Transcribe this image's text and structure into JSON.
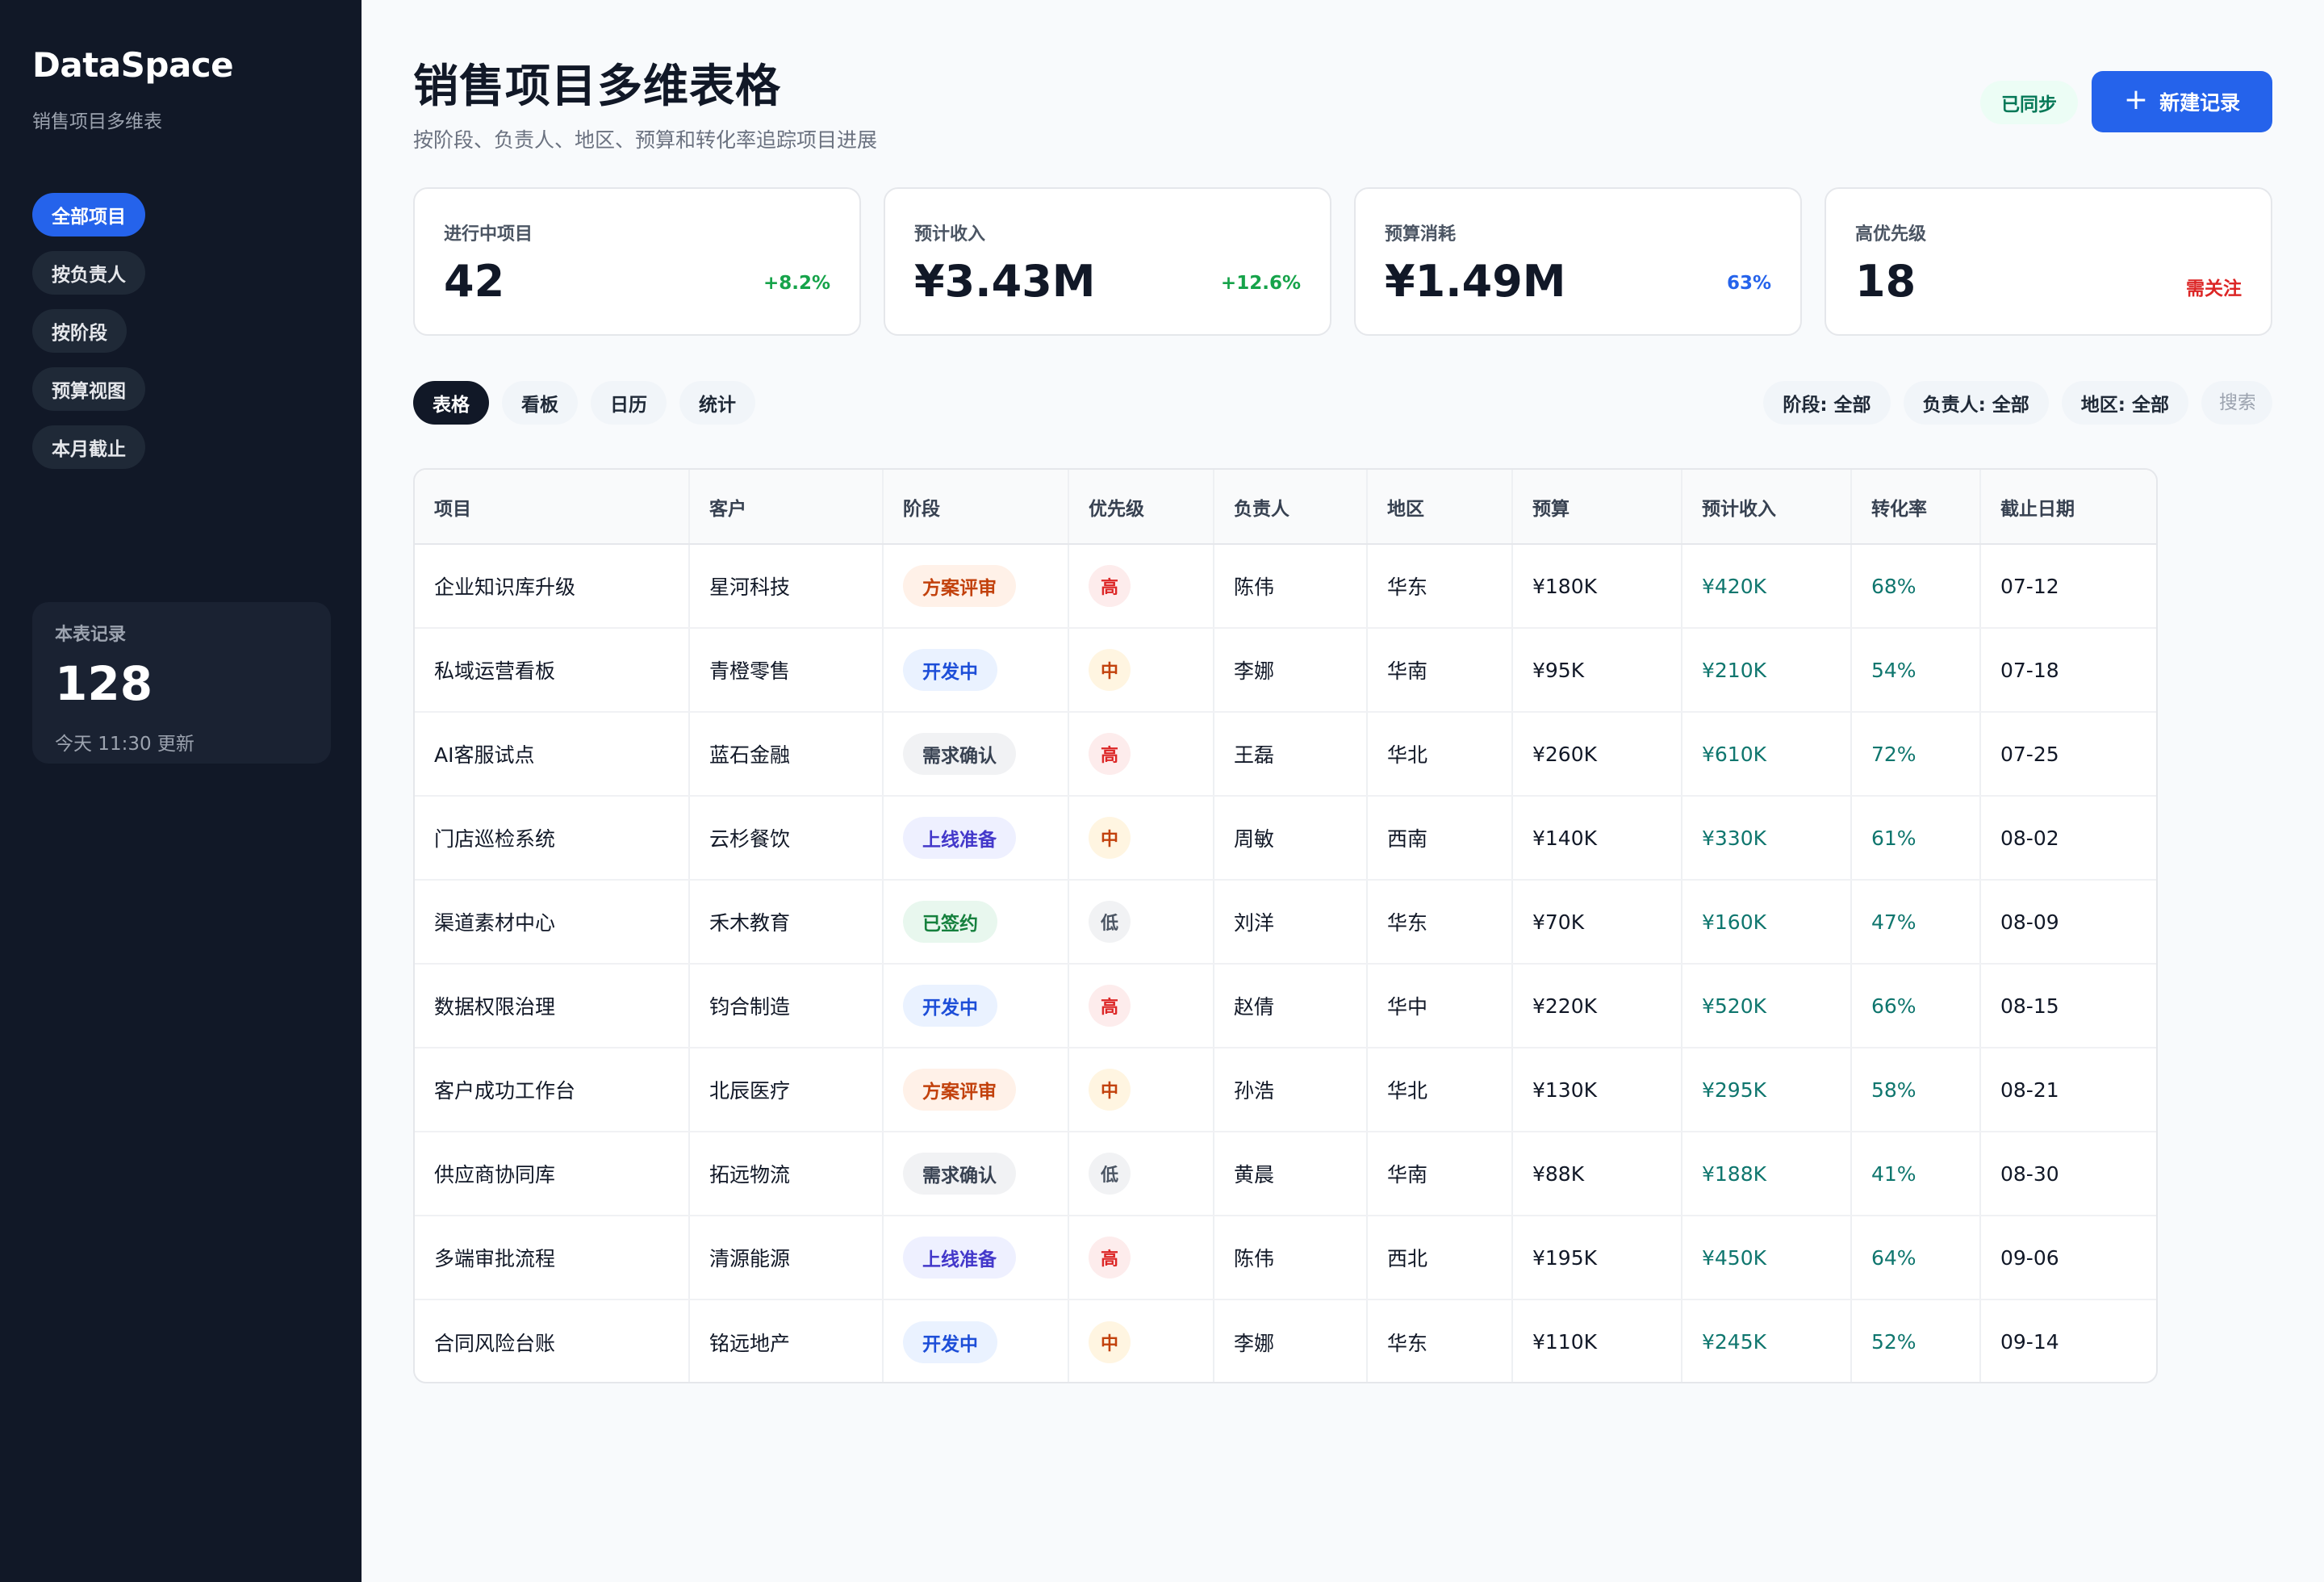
{
  "sidebar": {
    "brand": "DataSpace",
    "subtitle": "销售项目多维表",
    "nav": [
      {
        "label": "全部项目",
        "active": true
      },
      {
        "label": "按负责人",
        "active": false
      },
      {
        "label": "按阶段",
        "active": false
      },
      {
        "label": "预算视图",
        "active": false
      },
      {
        "label": "本月截止",
        "active": false
      }
    ],
    "records": {
      "label": "本表记录",
      "value": "128",
      "updated": "今天 11:30 更新"
    }
  },
  "header": {
    "title": "销售项目多维表格",
    "subtitle": "按阶段、负责人、地区、预算和转化率追踪项目进展",
    "sync_label": "已同步",
    "new_button": "新建记录"
  },
  "kpis": [
    {
      "label": "进行中项目",
      "value": "42",
      "delta": "+8.2%",
      "color": "#16a34a"
    },
    {
      "label": "预计收入",
      "value": "¥3.43M",
      "delta": "+12.6%",
      "color": "#16a34a"
    },
    {
      "label": "预算消耗",
      "value": "¥1.49M",
      "delta": "63%",
      "color": "#2563eb"
    },
    {
      "label": "高优先级",
      "value": "18",
      "delta": "需关注",
      "color": "#dc2626"
    }
  ],
  "view_tabs": [
    {
      "label": "表格",
      "active": true
    },
    {
      "label": "看板",
      "active": false
    },
    {
      "label": "日历",
      "active": false
    },
    {
      "label": "统计",
      "active": false
    }
  ],
  "filters": {
    "stage": "阶段: 全部",
    "owner": "负责人: 全部",
    "region": "地区: 全部",
    "search_placeholder": "搜索"
  },
  "stage_colors": {
    "方案评审": {
      "bg": "#fff1e8",
      "fg": "#c2410c"
    },
    "开发中": {
      "bg": "#eaf2ff",
      "fg": "#1d4ed8"
    },
    "需求确认": {
      "bg": "#f1f2f4",
      "fg": "#374151"
    },
    "上线准备": {
      "bg": "#eef0ff",
      "fg": "#4338ca"
    },
    "已签约": {
      "bg": "#e8f7ee",
      "fg": "#15803d"
    }
  },
  "priority_colors": {
    "高": {
      "bg": "#fdecec",
      "fg": "#dc2626"
    },
    "中": {
      "bg": "#fff5e1",
      "fg": "#c2410c"
    },
    "低": {
      "bg": "#f1f2f4",
      "fg": "#4b5563"
    }
  },
  "table": {
    "columns": [
      "项目",
      "客户",
      "阶段",
      "优先级",
      "负责人",
      "地区",
      "预算",
      "预计收入",
      "转化率",
      "截止日期"
    ],
    "rows": [
      {
        "project": "企业知识库升级",
        "client": "星河科技",
        "stage": "方案评审",
        "priority": "高",
        "owner": "陈伟",
        "region": "华东",
        "budget": "¥180K",
        "revenue": "¥420K",
        "conversion": "68%",
        "due": "07-12"
      },
      {
        "project": "私域运营看板",
        "client": "青橙零售",
        "stage": "开发中",
        "priority": "中",
        "owner": "李娜",
        "region": "华南",
        "budget": "¥95K",
        "revenue": "¥210K",
        "conversion": "54%",
        "due": "07-18"
      },
      {
        "project": "AI客服试点",
        "client": "蓝石金融",
        "stage": "需求确认",
        "priority": "高",
        "owner": "王磊",
        "region": "华北",
        "budget": "¥260K",
        "revenue": "¥610K",
        "conversion": "72%",
        "due": "07-25"
      },
      {
        "project": "门店巡检系统",
        "client": "云杉餐饮",
        "stage": "上线准备",
        "priority": "中",
        "owner": "周敏",
        "region": "西南",
        "budget": "¥140K",
        "revenue": "¥330K",
        "conversion": "61%",
        "due": "08-02"
      },
      {
        "project": "渠道素材中心",
        "client": "禾木教育",
        "stage": "已签约",
        "priority": "低",
        "owner": "刘洋",
        "region": "华东",
        "budget": "¥70K",
        "revenue": "¥160K",
        "conversion": "47%",
        "due": "08-09"
      },
      {
        "project": "数据权限治理",
        "client": "钧合制造",
        "stage": "开发中",
        "priority": "高",
        "owner": "赵倩",
        "region": "华中",
        "budget": "¥220K",
        "revenue": "¥520K",
        "conversion": "66%",
        "due": "08-15"
      },
      {
        "project": "客户成功工作台",
        "client": "北辰医疗",
        "stage": "方案评审",
        "priority": "中",
        "owner": "孙浩",
        "region": "华北",
        "budget": "¥130K",
        "revenue": "¥295K",
        "conversion": "58%",
        "due": "08-21"
      },
      {
        "project": "供应商协同库",
        "client": "拓远物流",
        "stage": "需求确认",
        "priority": "低",
        "owner": "黄晨",
        "region": "华南",
        "budget": "¥88K",
        "revenue": "¥188K",
        "conversion": "41%",
        "due": "08-30"
      },
      {
        "project": "多端审批流程",
        "client": "清源能源",
        "stage": "上线准备",
        "priority": "高",
        "owner": "陈伟",
        "region": "西北",
        "budget": "¥195K",
        "revenue": "¥450K",
        "conversion": "64%",
        "due": "09-06"
      },
      {
        "project": "合同风险台账",
        "client": "铭远地产",
        "stage": "开发中",
        "priority": "中",
        "owner": "李娜",
        "region": "华东",
        "budget": "¥110K",
        "revenue": "¥245K",
        "conversion": "52%",
        "due": "09-14"
      }
    ]
  }
}
